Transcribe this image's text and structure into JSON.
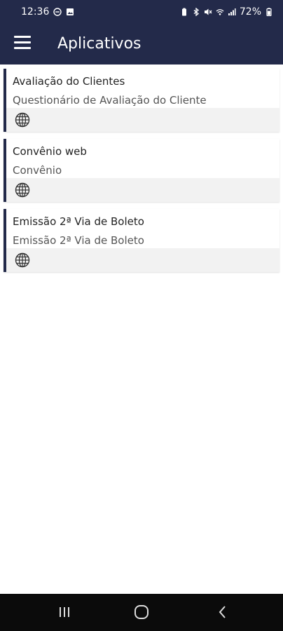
{
  "status": {
    "time": "12:36",
    "battery": "72%",
    "icons": [
      "do-not-disturb-icon",
      "image-icon",
      "battery-saver-icon",
      "bluetooth-icon",
      "mute-icon",
      "wifi-icon",
      "signal-icon",
      "battery-icon"
    ]
  },
  "app_bar": {
    "title": "Aplicativos",
    "menu_icon": "hamburger-menu-icon"
  },
  "apps": [
    {
      "title": "Avaliação do Clientes",
      "subtitle": "Questionário de Avaliação do Cliente",
      "icon": "globe-icon"
    },
    {
      "title": "Convênio web",
      "subtitle": "Convênio",
      "icon": "globe-icon"
    },
    {
      "title": "Emissão 2ª Via de Boleto",
      "subtitle": "Emissão 2ª Via de Boleto",
      "icon": "globe-icon"
    }
  ],
  "nav": {
    "icons": [
      "recent-apps-icon",
      "home-icon",
      "back-icon"
    ]
  },
  "colors": {
    "primary": "#232a4a",
    "card_footer": "#f2f2f2",
    "nav_bar": "#0b0b0b"
  }
}
